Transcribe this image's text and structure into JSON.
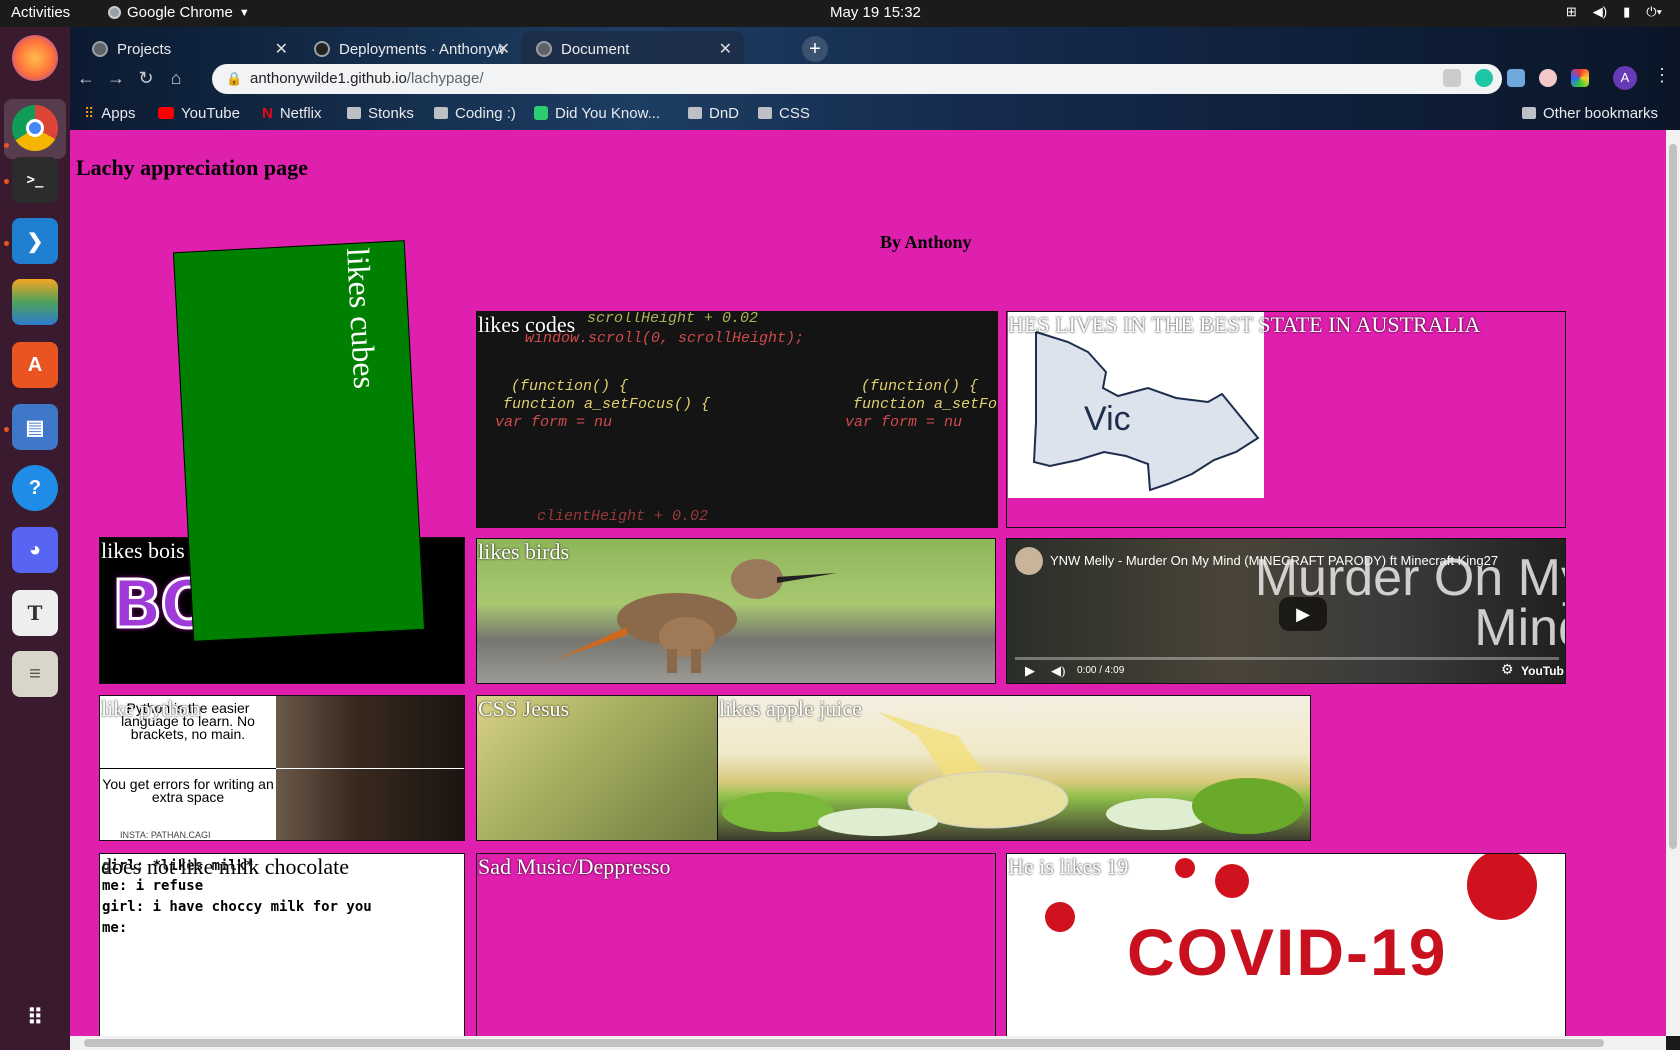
{
  "os": {
    "activities": "Activities",
    "app_name": "Google Chrome",
    "clock": "May 19  15:32"
  },
  "browser": {
    "tabs": [
      {
        "title": "Projects"
      },
      {
        "title": "Deployments · Anthonyw"
      },
      {
        "title": "Document"
      }
    ],
    "url_host": "anthonywilde1.github.io",
    "url_path": "/lachypage/",
    "profile_initial": "A",
    "bookmarks": [
      {
        "label": "Apps"
      },
      {
        "label": "YouTube"
      },
      {
        "label": "Netflix"
      },
      {
        "label": "Stonks"
      },
      {
        "label": "Coding :)"
      },
      {
        "label": "Did You Know..."
      },
      {
        "label": "DnD"
      },
      {
        "label": "CSS"
      }
    ],
    "other_bookmarks": "Other bookmarks"
  },
  "page": {
    "title": "Lachy appreciation page",
    "byline": "By Anthony",
    "cards": {
      "cubes": "likes cubes",
      "codes": "likes codes",
      "vic": "HES LIVES IN THE BEST STATE IN AUSTRALIA",
      "vic_map_label": "Vic",
      "bois": "likes bois",
      "bois_art": "BOIS!?!?",
      "birds": "likes birds",
      "video_title": "YNW Melly - Murder On My Mind (MINECRAFT PARODY) ft Minecraft King27",
      "video_overlay": "Murder On My Mind",
      "video_time": "0:00 / 4:09",
      "video_brand": "YouTub",
      "python": "like python",
      "python_meme_top": "Python is the easier language to learn. No brackets, no main.",
      "python_meme_bottom": "You get errors for writing an extra space",
      "python_meme_credit": "INSTA: PATHAN.CAGI",
      "jesus": "CSS Jesus",
      "juice": "likes apple juice",
      "choccy": "does not like milk chocolate",
      "choccy_lines": [
        "girl: *likes milk*",
        "me: i refuse",
        "girl: i have choccy milk for you",
        "me:"
      ],
      "sad": "Sad Music/Deppresso",
      "covid": "He is likes 19",
      "covid_big": "COVID-19"
    },
    "code_lines": [
      "window.scroll(0, scrollHeight);",
      "(function() {",
      "function a_setFocus() {",
      "var form = nu",
      "scrollHeight + 0.02",
      "clientHeight + 0.02"
    ]
  }
}
